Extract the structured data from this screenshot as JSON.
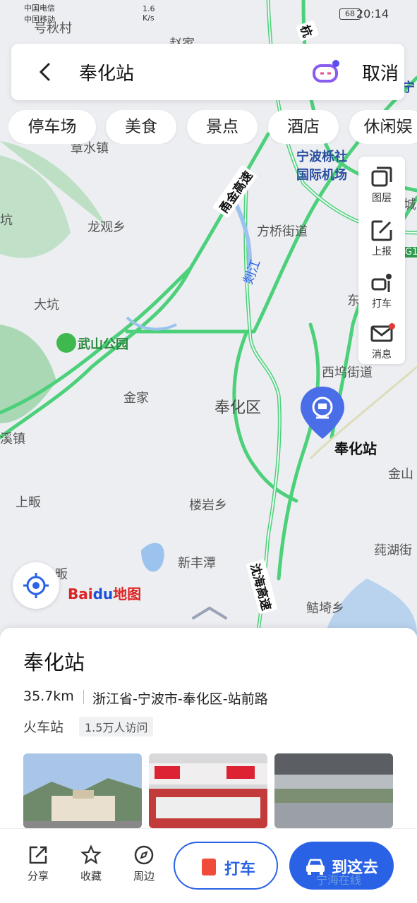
{
  "status": {
    "carrier1": "中国电信",
    "carrier2": "中国移动",
    "speed": "1.6",
    "speed_unit": "K/s",
    "battery": "68",
    "time": "20:14"
  },
  "search": {
    "query": "奉化站",
    "cancel": "取消"
  },
  "chips": [
    "停车场",
    "美食",
    "景点",
    "酒店",
    "休闲娱"
  ],
  "tools": [
    {
      "label": "图层",
      "icon": "layers-icon"
    },
    {
      "label": "上报",
      "icon": "report-icon"
    },
    {
      "label": "打车",
      "icon": "taxi-icon"
    },
    {
      "label": "消息",
      "icon": "message-icon"
    }
  ],
  "map": {
    "labels": [
      "号秋村",
      "杭",
      "宁",
      "赵家",
      "章水镇",
      "宁波栎社",
      "国际机场",
      "城",
      "坑",
      "龙观乡",
      "方桥街道",
      "剡江",
      "大坑",
      "武山公园",
      "东",
      "西坞街道",
      "金家",
      "奉化区",
      "溪镇",
      "金山",
      "上畈",
      "楼岩乡",
      "莼湖街",
      "新丰潭",
      "鲒埼乡",
      "畈",
      "G1"
    ],
    "roads": [
      "甬金高速",
      "沈海高速"
    ],
    "pin_label": "奉化站",
    "logo_a": "Bai",
    "logo_b": "du",
    "logo_c": "地图"
  },
  "place": {
    "title": "奉化站",
    "distance": "35.7km",
    "address": "浙江省-宁波市-奉化区-站前路",
    "category": "火车站",
    "visits": "1.5万人访问"
  },
  "bottom": {
    "share": "分享",
    "favorite": "收藏",
    "nearby": "周边",
    "taxi": "打车",
    "go": "到这去"
  },
  "watermark": "宁海在线",
  "colors": {
    "accent": "#2a62e6",
    "road": "#4cd07a",
    "pin": "#4a6ee8"
  }
}
